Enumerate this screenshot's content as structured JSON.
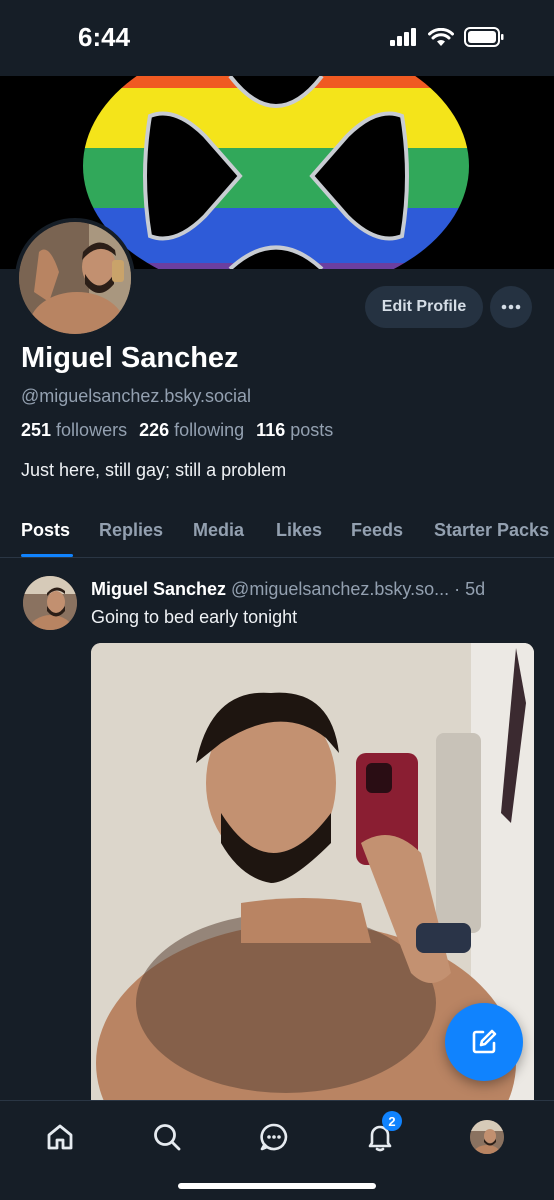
{
  "status_bar": {
    "time": "6:44"
  },
  "profile": {
    "name": "Miguel Sanchez",
    "handle": "@miguelsanchez.bsky.social",
    "followers_count": "251",
    "followers_label": "followers",
    "following_count": "226",
    "following_label": "following",
    "posts_count": "116",
    "posts_label": "posts",
    "bio": "Just here, still gay; still a problem",
    "edit_label": "Edit Profile"
  },
  "tabs": [
    {
      "label": "Posts"
    },
    {
      "label": "Replies"
    },
    {
      "label": "Media"
    },
    {
      "label": "Likes"
    },
    {
      "label": "Feeds"
    },
    {
      "label": "Starter Packs"
    }
  ],
  "post": {
    "author": "Miguel Sanchez",
    "handle": "@miguelsanchez.bsky.so...",
    "time": "· 5d",
    "text": "Going to bed early tonight"
  },
  "nav": {
    "notification_badge": "2"
  },
  "colors": {
    "accent": "#1083fe",
    "background": "#161e27",
    "muted": "#93a0b0"
  },
  "icons": [
    "signal-icon",
    "wifi-icon",
    "battery-icon",
    "ellipsis-icon",
    "compose-icon",
    "home-icon",
    "search-icon",
    "chat-icon",
    "bell-icon"
  ]
}
